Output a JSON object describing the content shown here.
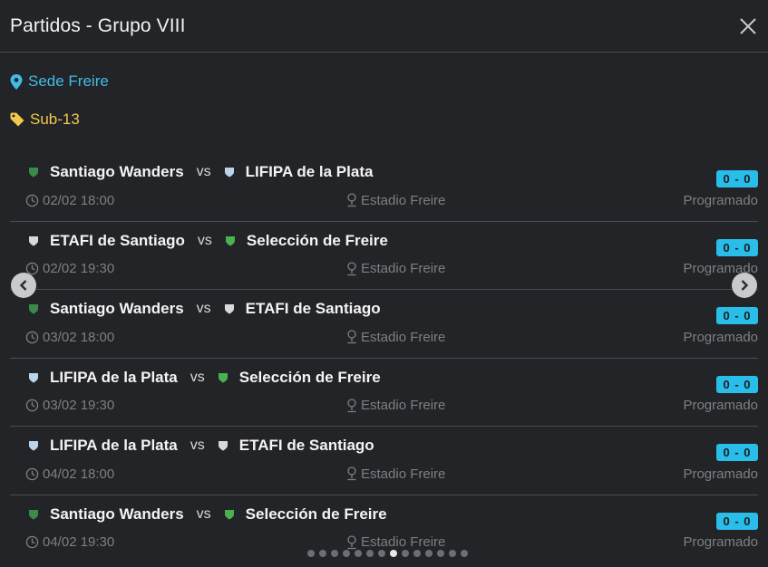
{
  "header": {
    "title": "Partidos - Grupo VIII",
    "close_icon": "close-icon"
  },
  "venue": {
    "label": "Sede Freire",
    "icon": "map-pin-icon",
    "color": "#3fbde6"
  },
  "category": {
    "label": "Sub-13",
    "icon": "tag-icon",
    "color": "#f2c94c"
  },
  "vs_label": "vs",
  "matches": [
    {
      "home": "Santiago Wanders",
      "home_crest": "#3a8a4a",
      "away": "LIFIPA de la Plata",
      "away_crest": "#bcd4ea",
      "score": "0 - 0",
      "datetime": "02/02 18:00",
      "stadium": "Estadio Freire",
      "status": "Programado"
    },
    {
      "home": "ETAFI de Santiago",
      "home_crest": "#d9d9d9",
      "away": "Selección de Freire",
      "away_crest": "#4caf50",
      "score": "0 - 0",
      "datetime": "02/02 19:30",
      "stadium": "Estadio Freire",
      "status": "Programado"
    },
    {
      "home": "Santiago Wanders",
      "home_crest": "#3a8a4a",
      "away": "ETAFI de Santiago",
      "away_crest": "#d9d9d9",
      "score": "0 - 0",
      "datetime": "03/02 18:00",
      "stadium": "Estadio Freire",
      "status": "Programado"
    },
    {
      "home": "LIFIPA de la Plata",
      "home_crest": "#bcd4ea",
      "away": "Selección de Freire",
      "away_crest": "#4caf50",
      "score": "0 - 0",
      "datetime": "03/02 19:30",
      "stadium": "Estadio Freire",
      "status": "Programado"
    },
    {
      "home": "LIFIPA de la Plata",
      "home_crest": "#bcd4ea",
      "away": "ETAFI de Santiago",
      "away_crest": "#d9d9d9",
      "score": "0 - 0",
      "datetime": "04/02 18:00",
      "stadium": "Estadio Freire",
      "status": "Programado"
    },
    {
      "home": "Santiago Wanders",
      "home_crest": "#3a8a4a",
      "away": "Selección de Freire",
      "away_crest": "#4caf50",
      "score": "0 - 0",
      "datetime": "04/02 19:30",
      "stadium": "Estadio Freire",
      "status": "Programado"
    }
  ],
  "carousel": {
    "prev_icon": "chevron-left-icon",
    "next_icon": "chevron-right-icon",
    "page_count": 14,
    "active_page": 8
  },
  "colors": {
    "background": "#232427",
    "accent": "#29bde9",
    "category": "#f2c94c",
    "muted": "#7e7f84"
  }
}
